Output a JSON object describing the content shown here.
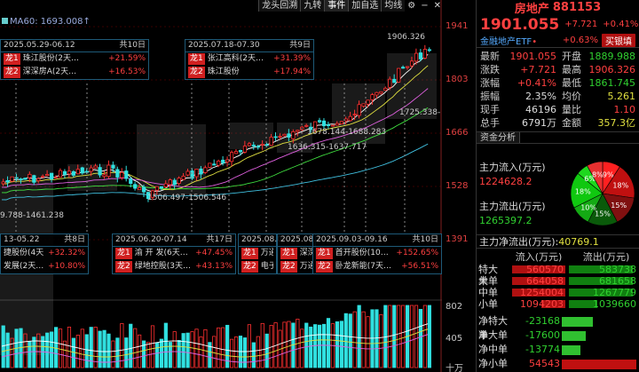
{
  "toolbar": {
    "buttons": [
      "龙头回溯",
      "九转",
      "事件",
      "加自选",
      "均线"
    ],
    "active_index": 2,
    "icons": [
      "settings-icon",
      "minus-icon",
      "close-icon"
    ]
  },
  "ma_label": "MA60: 1693.008↑",
  "price_axis": [
    "1941",
    "1803",
    "1666",
    "1528",
    "1391"
  ],
  "volume_axis": [
    "802",
    "405",
    "十万"
  ],
  "annotations_top": [
    {
      "period": "2025.05.29-06.12",
      "days": "共10日",
      "rows": [
        {
          "tag": "龙1",
          "name": "珠江股份(2天…",
          "pct": "+21.59%"
        },
        {
          "tag": "龙2",
          "name": "深深房A(2天…",
          "pct": "+16.53%"
        }
      ]
    },
    {
      "period": "2025.07.18-07.30",
      "days": "共9日",
      "rows": [
        {
          "tag": "龙1",
          "name": "张江高科(2天…",
          "pct": "+31.39%"
        },
        {
          "tag": "龙2",
          "name": "珠江股份",
          "pct": "+17.94%"
        }
      ]
    }
  ],
  "annotations_bottom": [
    {
      "period": "13-05.22",
      "days": "共8日",
      "rows": [
        {
          "tag": "",
          "name": "捷股份(4天…",
          "pct": "+32.32%"
        },
        {
          "tag": "",
          "name": "发展(2天…",
          "pct": "+10.80%"
        }
      ]
    },
    {
      "period": "2025.06.20-07.14",
      "days": "共17日",
      "rows": [
        {
          "tag": "龙1",
          "name": "渝 开 发(6天…",
          "pct": "+47.45%"
        },
        {
          "tag": "龙2",
          "name": "绿地控股(3天…",
          "pct": "+43.13%"
        }
      ]
    },
    {
      "period": "2025.08.0",
      "days": "",
      "rows": [
        {
          "tag": "龙1",
          "name": "万通",
          "pct": ""
        },
        {
          "tag": "龙2",
          "name": "电子",
          "pct": ""
        }
      ]
    },
    {
      "period": "2025.08.1",
      "days": "",
      "rows": [
        {
          "tag": "龙1",
          "name": "深深",
          "pct": ""
        },
        {
          "tag": "龙2",
          "name": "万通",
          "pct": ""
        }
      ]
    },
    {
      "period": "2025.09.03-09.16",
      "days": "共10日",
      "rows": [
        {
          "tag": "龙1",
          "name": "首开股份(10…",
          "pct": "+152.65%"
        },
        {
          "tag": "龙2",
          "name": "卧龙新能(7天…",
          "pct": "+56.51%"
        }
      ]
    }
  ],
  "ranges": [
    "1906.326",
    "1725.338-",
    "1678.144-1688.283",
    "1636.315-1637.717",
    "1506.497-1506.546",
    "9.788-1461.238"
  ],
  "header": {
    "title": "房地产",
    "code": "881153",
    "price": "1901.055",
    "change": "+7.721",
    "change_pct": "+0.41%",
    "etf": "金融地产ETF",
    "etf_dot": "•",
    "etf_change": "+0.63%",
    "buy_button": "买银填"
  },
  "stats": [
    {
      "l": "最新",
      "v": "1901.055",
      "vc": "red",
      "l2": "开盘",
      "v2": "1889.988",
      "v2c": "green"
    },
    {
      "l": "涨跌",
      "v": "+7.721",
      "vc": "red",
      "l2": "最高",
      "v2": "1906.326",
      "v2c": "red"
    },
    {
      "l": "涨幅",
      "v": "+0.41%",
      "vc": "red",
      "l2": "最低",
      "v2": "1861.745",
      "v2c": "green"
    },
    {
      "l": "振幅",
      "v": "2.35%",
      "vc": "white",
      "l2": "均价",
      "v2": "5.261",
      "v2c": "yellow"
    },
    {
      "l": "现手",
      "v": "46196",
      "vc": "white",
      "l2": "量比",
      "v2": "1.10",
      "v2c": "red"
    },
    {
      "l": "总手",
      "v": "6791万",
      "vc": "white",
      "l2": "金额",
      "v2": "357.3亿",
      "v2c": "yellow"
    }
  ],
  "tabs": [
    "资金分析",
    ""
  ],
  "flow": {
    "in_label": "主力流入(万元)",
    "in_value": "1224628.2",
    "out_label": "主力流出(万元)",
    "out_value": "1265397.2"
  },
  "pie": [
    {
      "label": "9%",
      "value": 9,
      "color": "#ff2020"
    },
    {
      "label": "18%",
      "value": 18,
      "color": "#c01010"
    },
    {
      "label": "15%",
      "value": 15,
      "color": "#801010"
    },
    {
      "label": "15%",
      "value": 15,
      "color": "#0a5a0a"
    },
    {
      "label": "10%",
      "value": 10,
      "color": "#14aa14"
    },
    {
      "label": "18%",
      "value": 18,
      "color": "#10c810"
    },
    {
      "label": "6%",
      "value": 6,
      "color": "#1ed81e"
    },
    {
      "label": "8%",
      "value": 8,
      "color": "#e83030"
    }
  ],
  "net": {
    "label": "主力净流出(万元):",
    "value": "40769.1"
  },
  "order_table": {
    "headers": [
      "",
      "流入(万元)",
      "流出(万元)"
    ],
    "rows": [
      {
        "label": "特大单",
        "in": "560570",
        "out": "583738",
        "in_frac": 1.0,
        "out_frac": 1.0
      },
      {
        "label": "大单",
        "in": "664058",
        "out": "681658",
        "in_frac": 1.0,
        "out_frac": 1.0
      },
      {
        "label": "中单",
        "in": "1254004",
        "out": "1267779",
        "in_frac": 1.0,
        "out_frac": 1.0
      },
      {
        "label": "小单",
        "in": "1094203",
        "out": "1039660",
        "in_frac": 0.45,
        "out_frac": 0.45
      }
    ]
  },
  "net_bars": [
    {
      "label": "净特大单",
      "value": "-23168",
      "frac": -0.42
    },
    {
      "label": "净大单",
      "value": "-17600",
      "frac": -0.32
    },
    {
      "label": "净中单",
      "value": "-13774",
      "frac": -0.25
    },
    {
      "label": "净小单",
      "value": "54543",
      "frac": 1.0
    }
  ]
}
